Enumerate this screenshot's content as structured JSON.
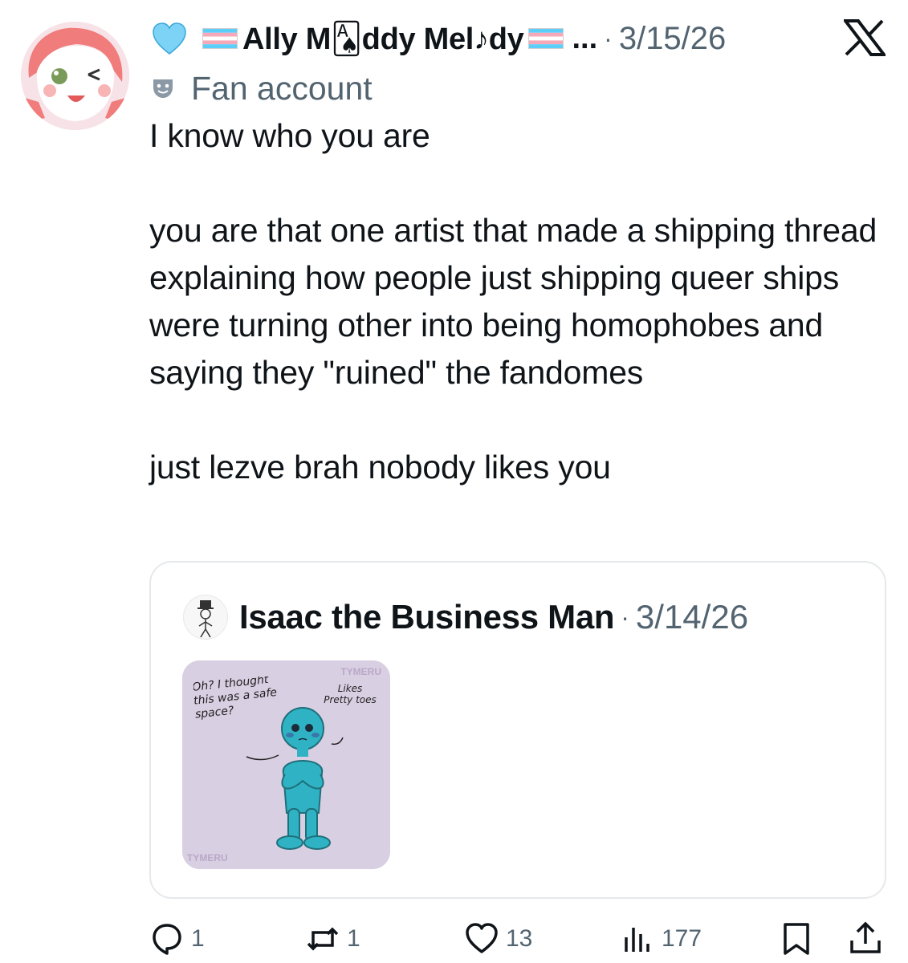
{
  "author": {
    "display_name": "Ally M🂡ddy Mel♪dy",
    "truncation": "...",
    "date": "3/15/26",
    "label": "Fan account"
  },
  "tweet": {
    "text": "I know who you are\n\nyou are that one artist that made a shipping thread explaining how people just shipping queer ships were turning other into being homophobes and saying they \"ruined\" the fandomes\n\njust lezve brah nobody likes you"
  },
  "quote": {
    "display_name": "Isaac the Business Man",
    "date": "3/14/26",
    "image": {
      "left_text": "Oh? I thought this was a safe space?",
      "right_text": "Likes Pretty toes",
      "watermark": "TYMERU"
    }
  },
  "actions": {
    "replies": "1",
    "reposts": "1",
    "likes": "13",
    "views": "177"
  },
  "colors": {
    "text": "#0f1419",
    "muted": "#536471",
    "border": "#e6e9eb",
    "heart": "#7dd3f5",
    "trans_blue": "#5bcefa",
    "trans_pink": "#f5a9b8"
  },
  "icons": [
    "blue-heart-icon",
    "trans-flag-icon",
    "x-logo-icon",
    "theater-mask-icon",
    "reply-icon",
    "repost-icon",
    "like-icon",
    "views-icon",
    "bookmark-icon",
    "share-icon"
  ]
}
